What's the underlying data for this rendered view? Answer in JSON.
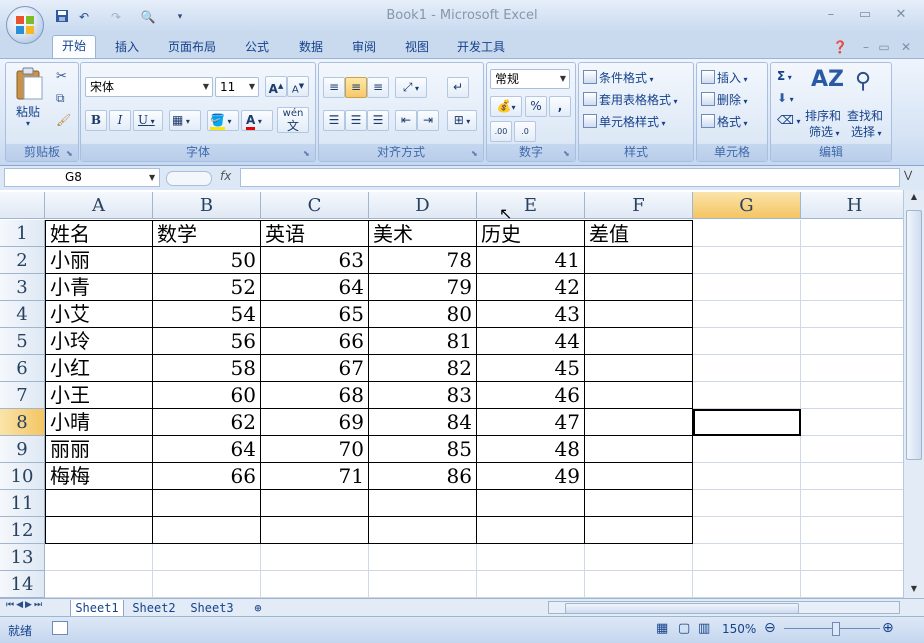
{
  "title": "Book1 - Microsoft Excel",
  "window_controls": {
    "minimize": "–",
    "restore": "▭",
    "close": "✕"
  },
  "ribbon_tabs": [
    "开始",
    "插入",
    "页面布局",
    "公式",
    "数据",
    "审阅",
    "视图",
    "开发工具"
  ],
  "ribbon": {
    "clipboard": {
      "paste": "粘贴",
      "label": "剪贴板"
    },
    "font": {
      "name": "宋体",
      "size": "11",
      "bold": "B",
      "italic": "I",
      "underline": "U",
      "label": "字体",
      "phonetic": "wén",
      "grow": "A",
      "shrink": "A"
    },
    "alignment": {
      "label": "对齐方式"
    },
    "number": {
      "format": "常规",
      "percent": "%",
      "comma": ",",
      "label": "数字"
    },
    "styles": {
      "conditional": "条件格式",
      "table": "套用表格格式",
      "cell": "单元格样式",
      "label": "样式"
    },
    "cells": {
      "insert": "插入",
      "delete": "删除",
      "format": "格式",
      "label": "单元格"
    },
    "editing": {
      "sort": "排序和",
      "sort2": "筛选",
      "find": "查找和",
      "find2": "选择",
      "label": "编辑",
      "sigma": "Σ"
    }
  },
  "name_box": "G8",
  "fx": "fx",
  "columns": [
    "A",
    "B",
    "C",
    "D",
    "E",
    "F",
    "G",
    "H"
  ],
  "rows": [
    "1",
    "2",
    "3",
    "4",
    "5",
    "6",
    "7",
    "8",
    "9",
    "10",
    "11",
    "12",
    "13",
    "14"
  ],
  "headers": [
    "姓名",
    "数学",
    "英语",
    "美术",
    "历史",
    "差值"
  ],
  "data": [
    [
      "小丽",
      "50",
      "63",
      "78",
      "41"
    ],
    [
      "小青",
      "52",
      "64",
      "79",
      "42"
    ],
    [
      "小艾",
      "54",
      "65",
      "80",
      "43"
    ],
    [
      "小玲",
      "56",
      "66",
      "81",
      "44"
    ],
    [
      "小红",
      "58",
      "67",
      "82",
      "45"
    ],
    [
      "小王",
      "60",
      "68",
      "83",
      "46"
    ],
    [
      "小晴",
      "62",
      "69",
      "84",
      "47"
    ],
    [
      "丽丽",
      "64",
      "70",
      "85",
      "48"
    ],
    [
      "梅梅",
      "66",
      "71",
      "86",
      "49"
    ]
  ],
  "sheets": [
    "Sheet1",
    "Sheet2",
    "Sheet3"
  ],
  "status": {
    "ready": "就绪",
    "zoom": "150%"
  },
  "colors": {
    "accent": "#15428b",
    "ribbon": "#dde8f6",
    "selected_header": "#f4c563"
  }
}
